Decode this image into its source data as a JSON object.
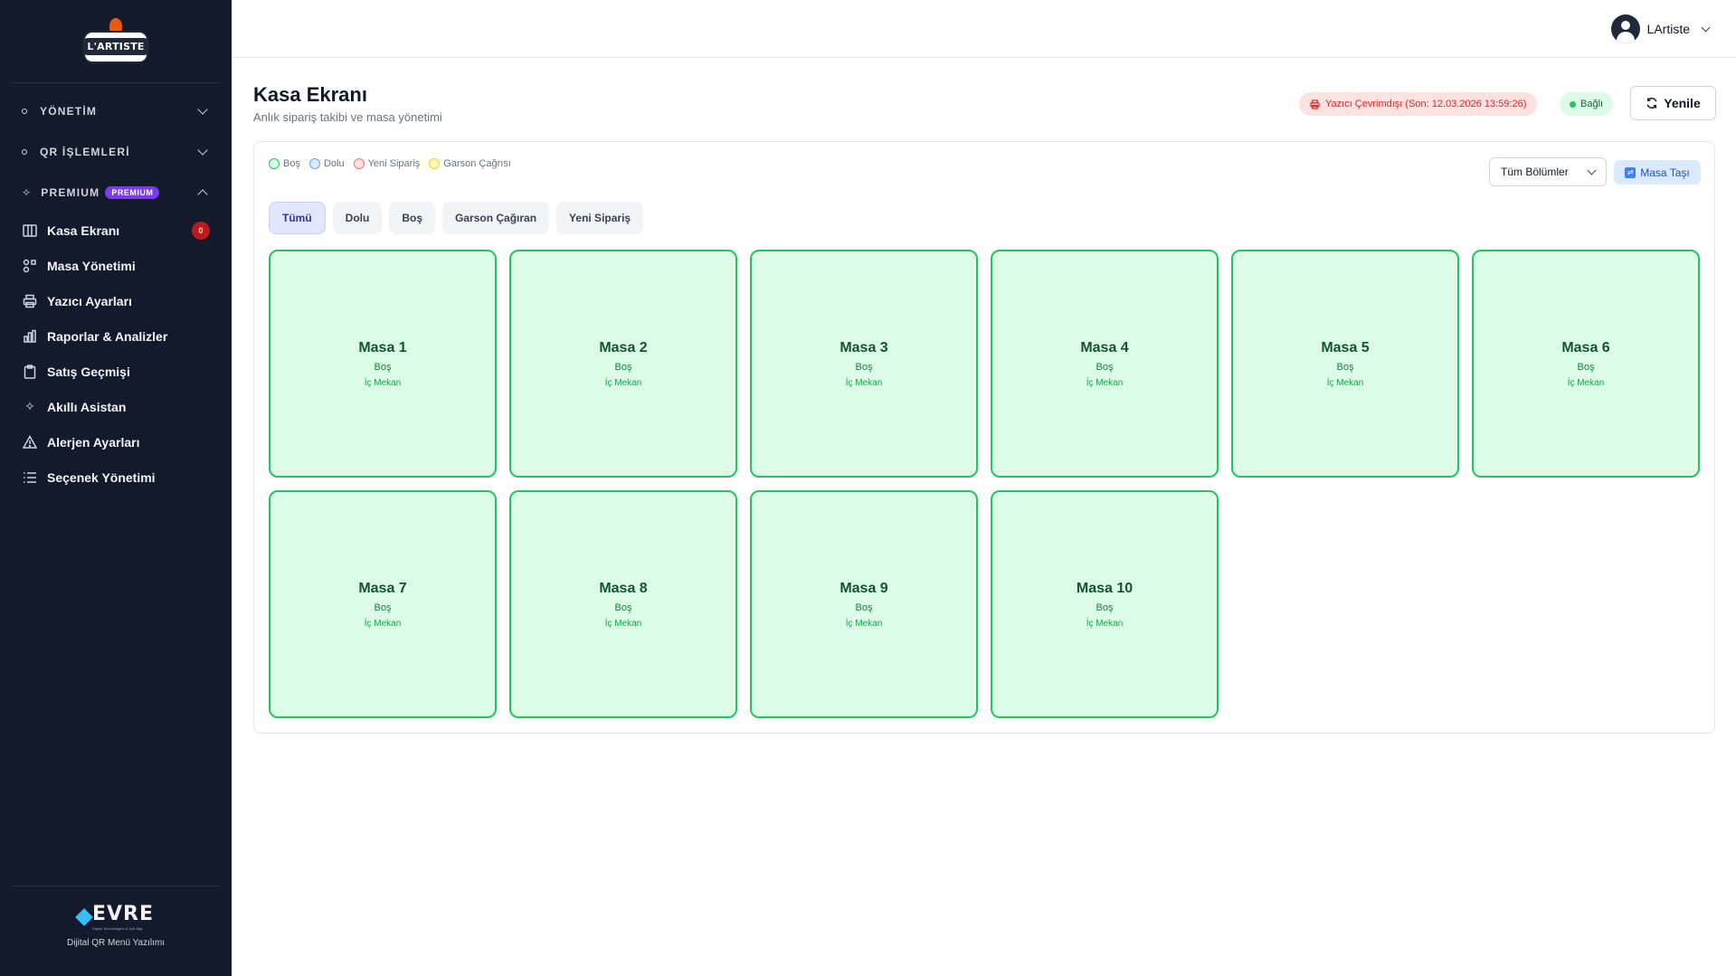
{
  "brand": {
    "logo_text": "L'ARTISTE"
  },
  "sidebar": {
    "sections": [
      {
        "label": "YÖNETİM",
        "icon": "dot-icon"
      },
      {
        "label": "QR İŞLEMLERİ",
        "icon": "dot-icon"
      },
      {
        "label": "PREMIUM",
        "icon": "sparkle-icon",
        "badge": "PREMIUM"
      }
    ],
    "items": [
      {
        "label": "Kasa Ekranı",
        "icon": "columns-icon",
        "badge": "0"
      },
      {
        "label": "Masa Yönetimi",
        "icon": "shapes-icon"
      },
      {
        "label": "Yazıcı Ayarları",
        "icon": "printer-icon"
      },
      {
        "label": "Raporlar & Analizler",
        "icon": "bar-chart-icon"
      },
      {
        "label": "Satış Geçmişi",
        "icon": "clipboard-icon"
      },
      {
        "label": "Akıllı Asistan",
        "icon": "sparkle-icon"
      },
      {
        "label": "Alerjen Ayarları",
        "icon": "warning-icon"
      },
      {
        "label": "Seçenek Yönetimi",
        "icon": "list-icon"
      }
    ],
    "footer": {
      "logo_text": "EVRE",
      "logo_sub": "Digital Technologies & Soft Mgt.",
      "tagline": "Dijital QR Menü Yazılımı"
    }
  },
  "topbar": {
    "username": "LArtiste"
  },
  "page": {
    "title": "Kasa Ekranı",
    "subtitle": "Anlık sipariş takibi ve masa yönetimi",
    "printer_status": "Yazıcı Çevrimdışı (Son: 12.03.2026 13:59:26)",
    "connection_status": "Bağlı",
    "refresh_label": "Yenile"
  },
  "legend": [
    {
      "label": "Boş",
      "color": "#22c55e",
      "fill": "#dcfce7"
    },
    {
      "label": "Dolu",
      "color": "#60a5fa",
      "fill": "#dbeafe"
    },
    {
      "label": "Yeni Sipariş",
      "color": "#f87171",
      "fill": "#fee2e2"
    },
    {
      "label": "Garson Çağrısı",
      "color": "#facc15",
      "fill": "#fef9c3"
    }
  ],
  "section_select": {
    "value": "Tüm Bölümler"
  },
  "move_button": {
    "label": "Masa Taşı"
  },
  "filters": [
    {
      "label": "Tümü",
      "active": true
    },
    {
      "label": "Dolu",
      "active": false
    },
    {
      "label": "Boş",
      "active": false
    },
    {
      "label": "Garson Çağıran",
      "active": false
    },
    {
      "label": "Yeni Sipariş",
      "active": false
    }
  ],
  "tables": [
    {
      "name": "Masa 1",
      "status": "Boş",
      "location": "İç Mekan"
    },
    {
      "name": "Masa 2",
      "status": "Boş",
      "location": "İç Mekan"
    },
    {
      "name": "Masa 3",
      "status": "Boş",
      "location": "İç Mekan"
    },
    {
      "name": "Masa 4",
      "status": "Boş",
      "location": "İç Mekan"
    },
    {
      "name": "Masa 5",
      "status": "Boş",
      "location": "İç Mekan"
    },
    {
      "name": "Masa 6",
      "status": "Boş",
      "location": "İç Mekan"
    },
    {
      "name": "Masa 7",
      "status": "Boş",
      "location": "İç Mekan"
    },
    {
      "name": "Masa 8",
      "status": "Boş",
      "location": "İç Mekan"
    },
    {
      "name": "Masa 9",
      "status": "Boş",
      "location": "İç Mekan"
    },
    {
      "name": "Masa 10",
      "status": "Boş",
      "location": "İç Mekan"
    }
  ]
}
